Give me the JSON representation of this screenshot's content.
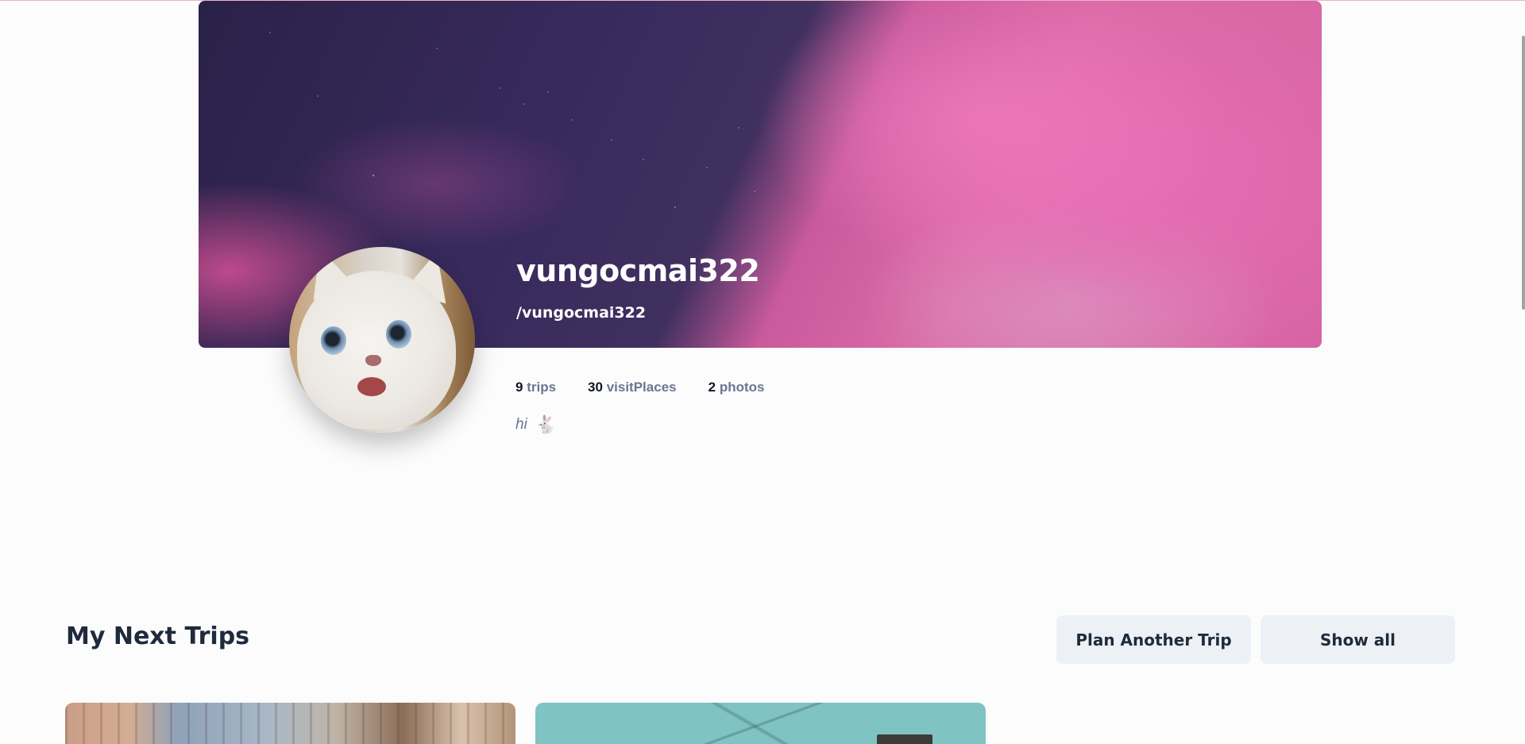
{
  "profile": {
    "display_name": "vungocmai322",
    "handle": "/vungocmai322",
    "bio": "hi",
    "bio_emoji": "🐇",
    "stats": [
      {
        "value": "9",
        "label": "trips"
      },
      {
        "value": "30",
        "label": "visitPlaces"
      },
      {
        "value": "2",
        "label": "photos"
      }
    ]
  },
  "next_trips": {
    "title": "My Next Trips",
    "plan_button": "Plan Another Trip",
    "show_all_button": "Show all"
  },
  "colors": {
    "page_bg": "#fcfcfd",
    "button_bg": "#edf1f5",
    "heading": "#1f2a3c",
    "muted": "#6b7790"
  }
}
